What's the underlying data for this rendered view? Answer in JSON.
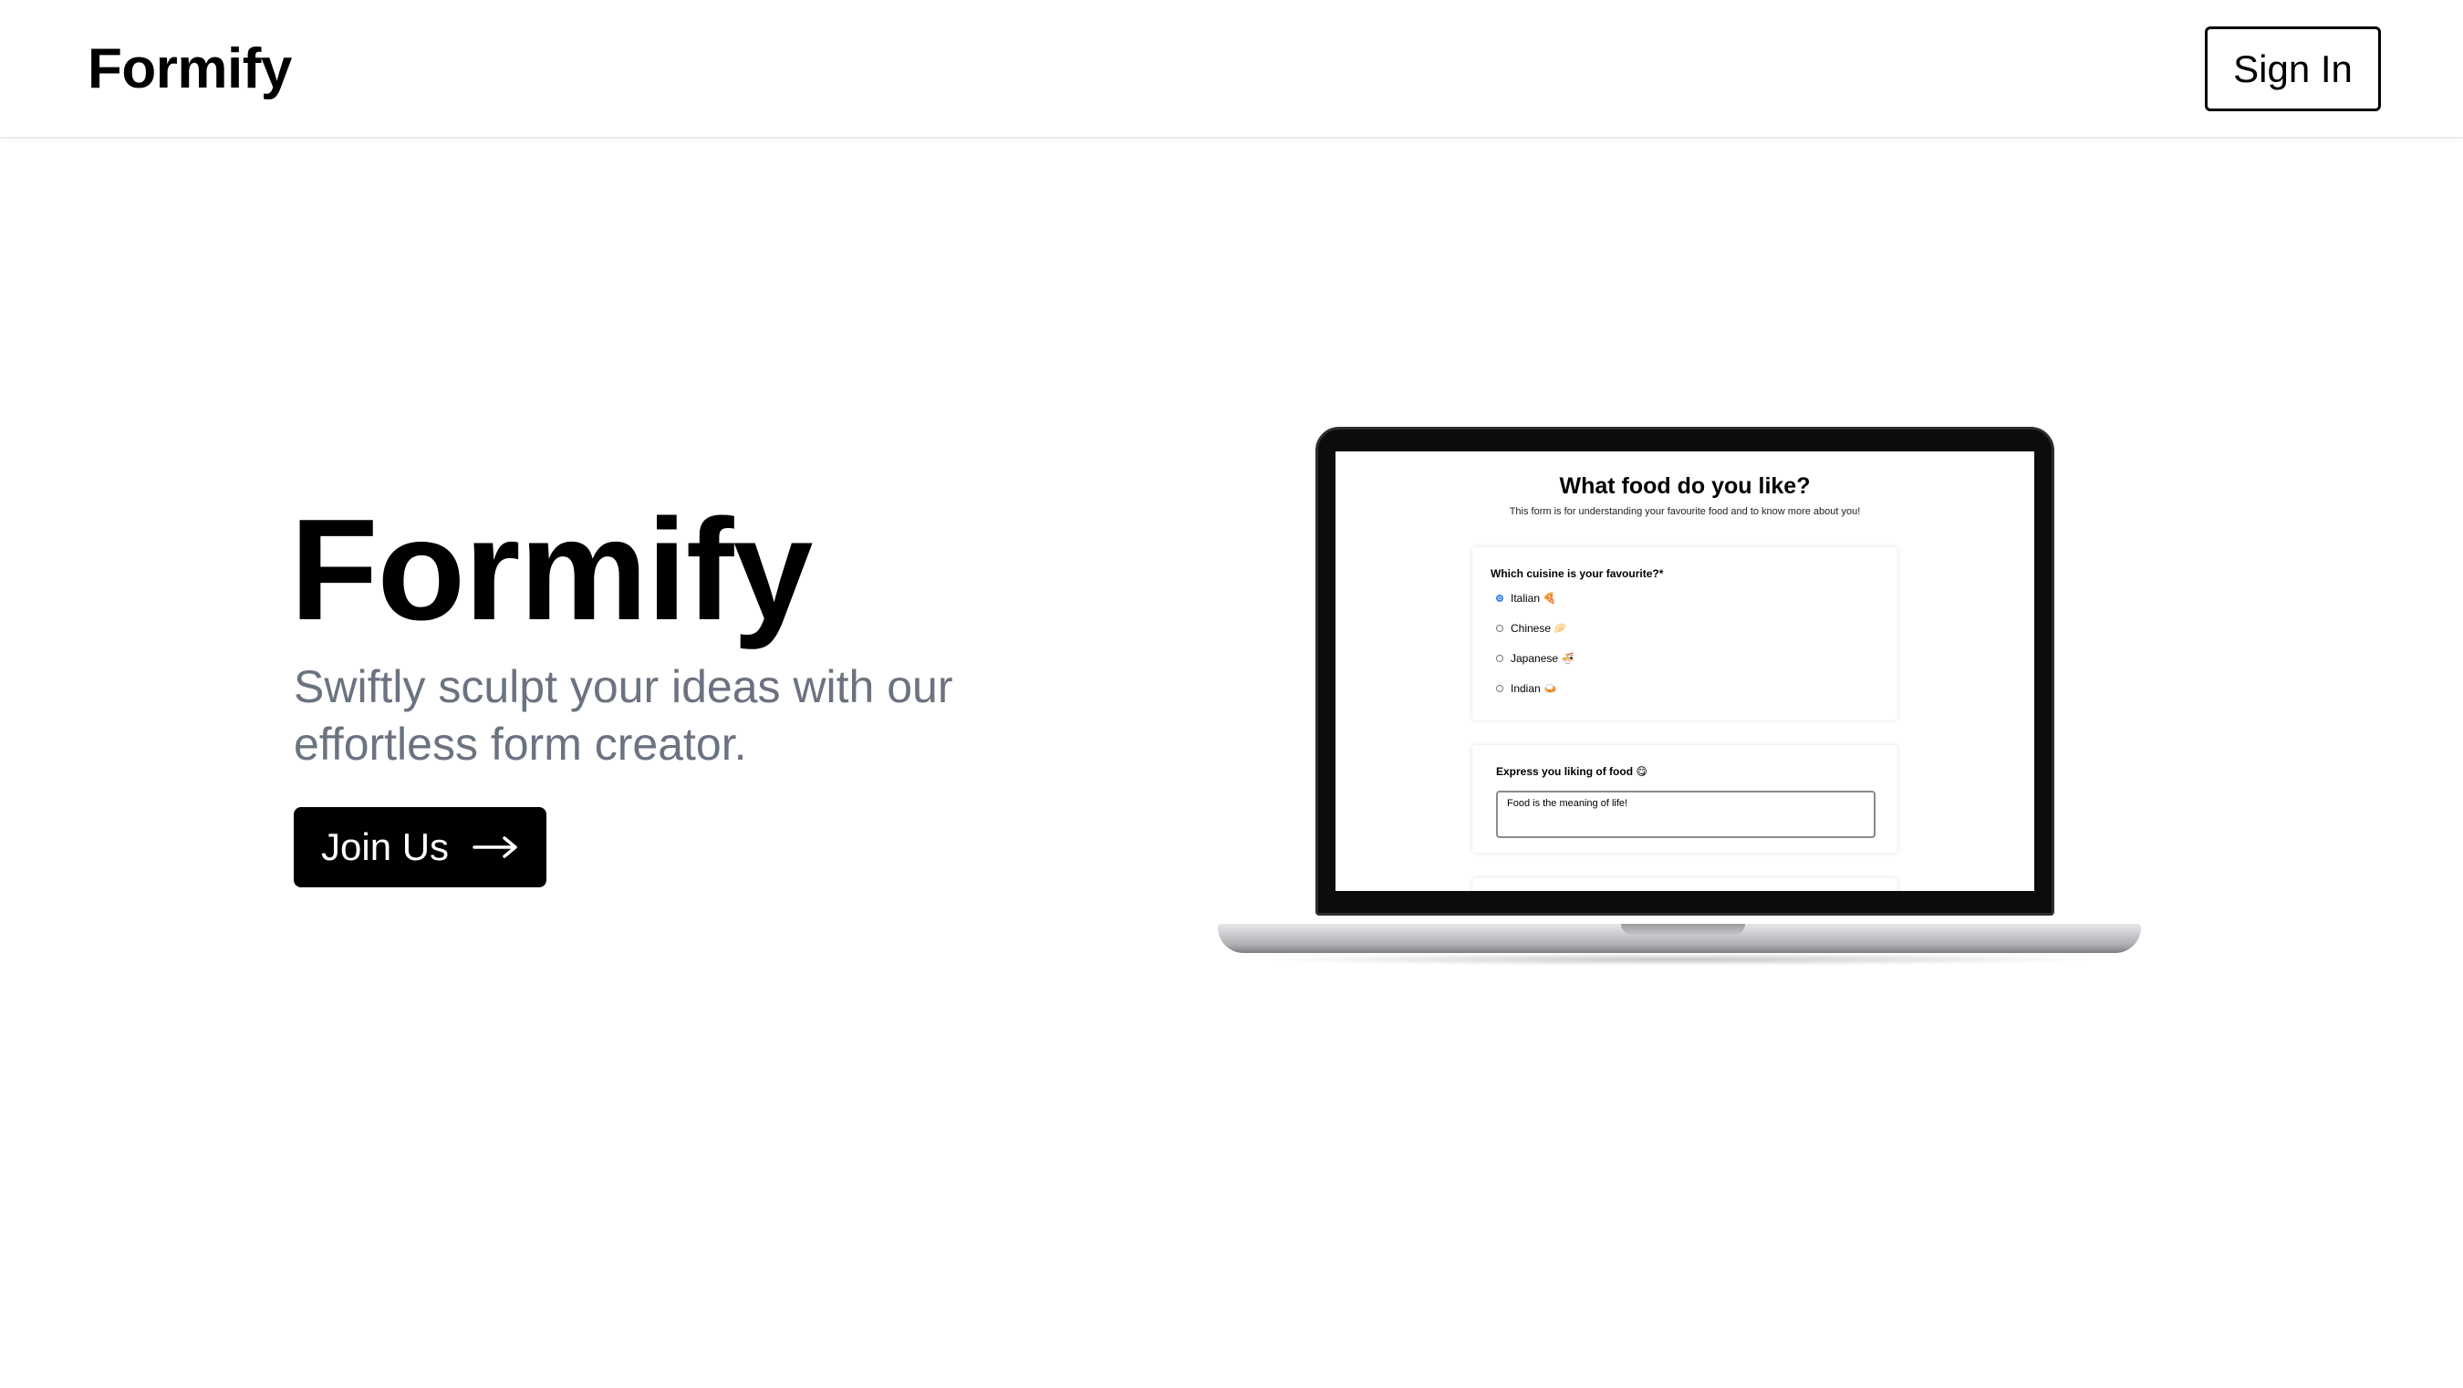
{
  "navbar": {
    "logo": "Formify",
    "sign_in_label": "Sign In"
  },
  "hero": {
    "title": "Formify",
    "subtitle": "Swiftly sculpt your ideas with our effortless form creator.",
    "cta_label": "Join Us"
  },
  "preview_form": {
    "title": "What food do you like?",
    "description": "This form is for understanding your favourite food and to know more about you!",
    "question1": {
      "label": "Which cuisine is your favourite?*",
      "options": [
        "Italian 🍕",
        "Chinese 🥟",
        "Japanese 🍜",
        "Indian 🍛"
      ],
      "selected_index": 0
    },
    "question2": {
      "label": "Express you liking of food 😋",
      "value": "Food is the meaning of life!"
    }
  },
  "colors": {
    "subtitle": "#6b7280",
    "button_bg": "#000000",
    "radio_accent": "#3b82f6"
  },
  "icons": {
    "cta": "arrow-right-icon"
  }
}
